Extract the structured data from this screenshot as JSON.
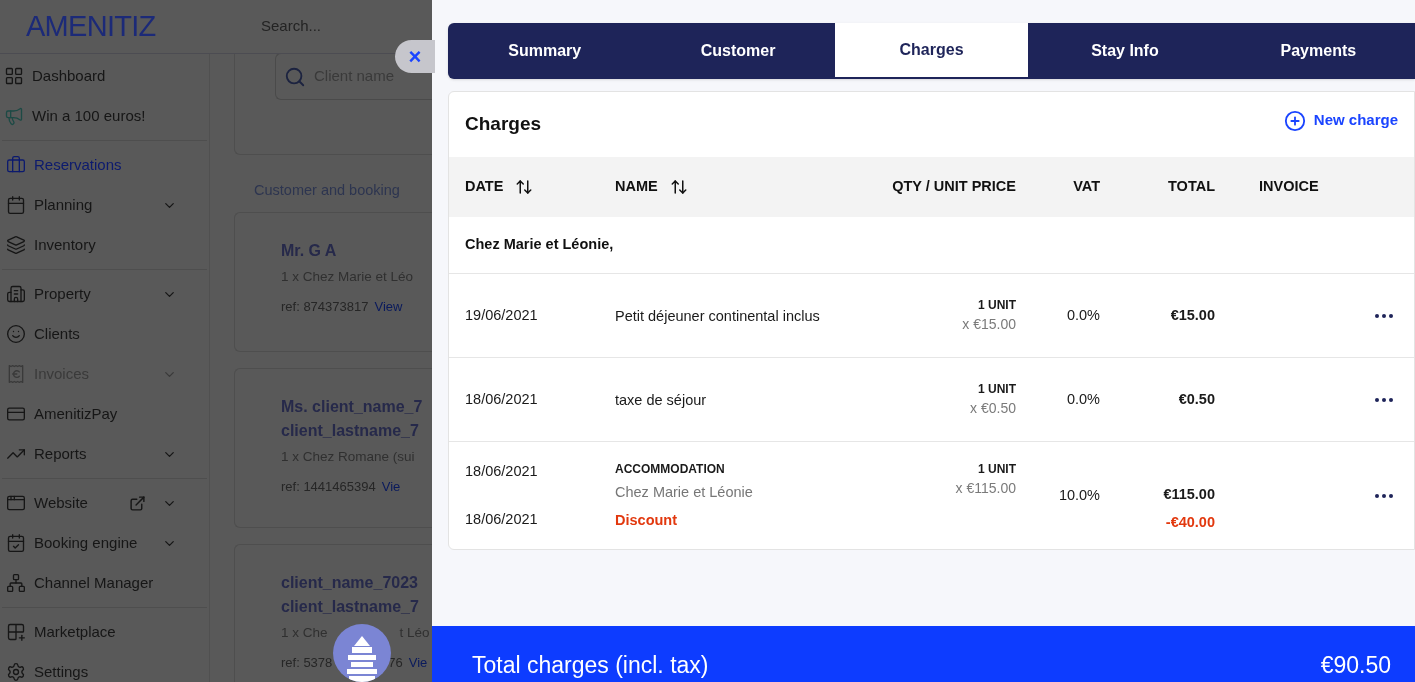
{
  "header": {
    "logo": "AMENITIZ",
    "search_placeholder": "Search..."
  },
  "sidebar": {
    "groups": [
      [
        {
          "label": "Dashboard",
          "selected": false,
          "disabled": false,
          "expandable": false,
          "external": false
        },
        {
          "label": "Win a 100 euros!",
          "selected": false,
          "disabled": false,
          "expandable": false,
          "external": false
        }
      ],
      [
        {
          "label": "Reservations",
          "selected": true,
          "disabled": false,
          "expandable": false,
          "external": false
        },
        {
          "label": "Planning",
          "selected": false,
          "disabled": false,
          "expandable": true,
          "external": false
        },
        {
          "label": "Inventory",
          "selected": false,
          "disabled": false,
          "expandable": false,
          "external": false
        }
      ],
      [
        {
          "label": "Property",
          "selected": false,
          "disabled": false,
          "expandable": true,
          "external": false
        },
        {
          "label": "Clients",
          "selected": false,
          "disabled": false,
          "expandable": false,
          "external": false
        },
        {
          "label": "Invoices",
          "selected": false,
          "disabled": true,
          "expandable": true,
          "external": false
        },
        {
          "label": "AmenitizPay",
          "selected": false,
          "disabled": false,
          "expandable": false,
          "external": false
        },
        {
          "label": "Reports",
          "selected": false,
          "disabled": false,
          "expandable": true,
          "external": false
        }
      ],
      [
        {
          "label": "Website",
          "selected": false,
          "disabled": false,
          "expandable": true,
          "external": true
        },
        {
          "label": "Booking engine",
          "selected": false,
          "disabled": false,
          "expandable": true,
          "external": false
        },
        {
          "label": "Channel Manager",
          "selected": false,
          "disabled": false,
          "expandable": false,
          "external": false
        }
      ],
      [
        {
          "label": "Marketplace",
          "selected": false,
          "disabled": false,
          "expandable": false,
          "external": false
        },
        {
          "label": "Settings",
          "selected": false,
          "disabled": false,
          "expandable": false,
          "external": false
        }
      ]
    ]
  },
  "bookings": {
    "search_placeholder": "Client name",
    "section_label": "Customer and booking",
    "cards": [
      {
        "name_lines": [
          "Mr. G A"
        ],
        "room_parts": [
          "1 x Chez Marie et Léo"
        ],
        "ref_parts": [
          "ref: 874373817"
        ],
        "link": "View"
      },
      {
        "name_lines": [
          "Ms. client_name_7",
          "client_lastname_7"
        ],
        "room_parts": [
          "1 x Chez Romane (sui"
        ],
        "ref_parts": [
          "ref: 1441465394"
        ],
        "link": "Vie"
      },
      {
        "name_lines": [
          "client_name_7023",
          "client_lastname_7"
        ],
        "room_parts": [
          "1 x Che",
          "t Léo"
        ],
        "ref_parts": [
          "ref: 5378",
          "76"
        ],
        "link": "Vie"
      }
    ]
  },
  "drawer": {
    "close": "×",
    "tabs": [
      {
        "label": "Summary",
        "selected": false
      },
      {
        "label": "Customer",
        "selected": false
      },
      {
        "label": "Charges",
        "selected": true
      },
      {
        "label": "Stay Info",
        "selected": false
      },
      {
        "label": "Payments",
        "selected": false
      }
    ],
    "charges": {
      "title": "Charges",
      "new_charge": "New charge",
      "columns": [
        {
          "label": "DATE",
          "sortable": true
        },
        {
          "label": "NAME",
          "sortable": true
        },
        {
          "label": "QTY / UNIT PRICE",
          "sortable": false
        },
        {
          "label": "VAT",
          "sortable": false
        },
        {
          "label": "TOTAL",
          "sortable": false
        },
        {
          "label": "INVOICE",
          "sortable": false
        }
      ],
      "group": "Chez Marie et Léonie,",
      "rows": [
        {
          "kind": "simple",
          "date": "19/06/2021",
          "name": "Petit déjeuner continental inclus",
          "qty": "1 UNIT",
          "unit_price": "x €15.00",
          "vat": "0.0%",
          "total": "€15.00"
        },
        {
          "kind": "simple",
          "date": "18/06/2021",
          "name": "taxe de séjour",
          "qty": "1 UNIT",
          "unit_price": "x €0.50",
          "vat": "0.0%",
          "total": "€0.50"
        },
        {
          "kind": "accommodation",
          "date": "18/06/2021",
          "category": "ACCOMMODATION",
          "name": "Chez Marie et Léonie",
          "qty": "1 UNIT",
          "unit_price": "x €115.00",
          "vat": "10.0%",
          "total": "€115.00",
          "discount": {
            "date": "18/06/2021",
            "label": "Discount",
            "amount": "-€40.00"
          }
        }
      ]
    },
    "footer": {
      "label": "Total charges (incl. tax)",
      "amount": "€90.50"
    }
  }
}
